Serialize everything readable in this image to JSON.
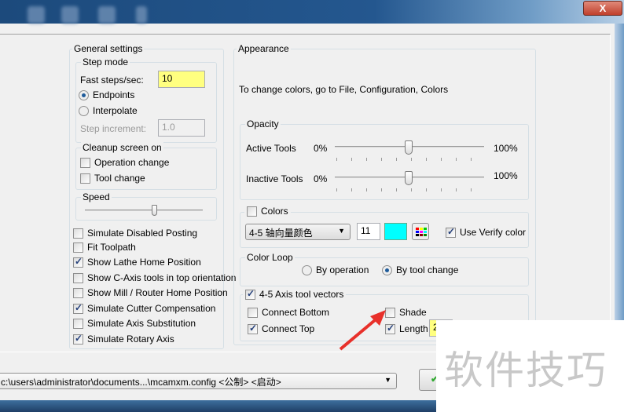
{
  "window": {
    "close_label": "X"
  },
  "general": {
    "title": "General settings",
    "step_mode": {
      "title": "Step mode",
      "fast_steps_label": "Fast steps/sec:",
      "fast_steps_value": "10",
      "endpoints": "Endpoints",
      "interpolate": "Interpolate",
      "step_increment_label": "Step increment:",
      "step_increment_value": "1.0",
      "selected": "Endpoints"
    },
    "cleanup": {
      "title": "Cleanup screen on",
      "operation_change": "Operation change",
      "tool_change": "Tool change"
    },
    "speed": {
      "title": "Speed",
      "value_fraction": 0.55
    },
    "options": [
      {
        "label": "Simulate Disabled Posting",
        "checked": false
      },
      {
        "label": "Fit Toolpath",
        "checked": false
      },
      {
        "label": "Show Lathe Home Position",
        "checked": true
      },
      {
        "label": "Show C-Axis tools in top orientation",
        "checked": false
      },
      {
        "label": "Show Mill / Router Home Position",
        "checked": false
      },
      {
        "label": "Simulate Cutter Compensation",
        "checked": true
      },
      {
        "label": "Simulate Axis Substitution",
        "checked": false
      },
      {
        "label": "Simulate Rotary Axis",
        "checked": true
      }
    ]
  },
  "appearance": {
    "title": "Appearance",
    "note": "To change colors, go to File, Configuration, Colors",
    "opacity": {
      "title": "Opacity",
      "active_label": "Active Tools",
      "inactive_label": "Inactive Tools",
      "min": "0%",
      "max": "100%",
      "active_value": 50,
      "inactive_value": 50
    },
    "colors": {
      "title": "Colors",
      "checked": false,
      "dropdown": "4-5 轴向量颜色",
      "number": "11",
      "swatch": "#00ffff",
      "use_verify": "Use Verify color",
      "use_verify_checked": true
    },
    "color_loop": {
      "title": "Color Loop",
      "by_operation": "By operation",
      "by_tool_change": "By tool change",
      "selected": "By tool change"
    },
    "vectors": {
      "title": "4-5 Axis tool vectors",
      "checked": true,
      "connect_bottom": "Connect Bottom",
      "connect_top": "Connect Top",
      "shade": "Shade",
      "length": "Length",
      "length_value": "2"
    }
  },
  "footer": {
    "config_path": "c:\\users\\administrator\\documents...\\mcamxm.config <公制> <启动>"
  },
  "watermark": "软件技巧"
}
